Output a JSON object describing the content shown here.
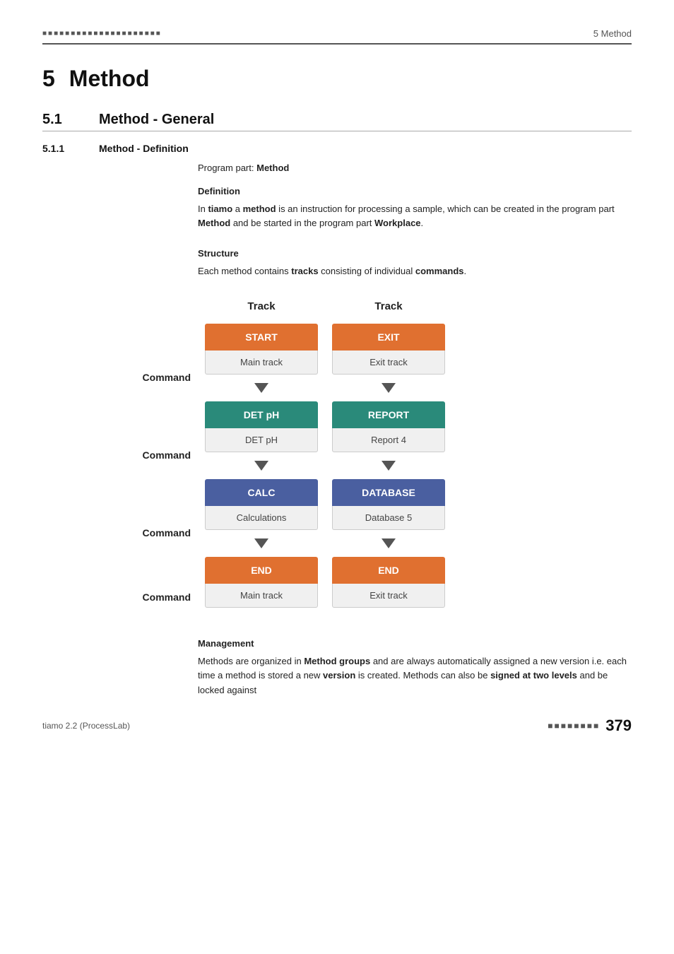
{
  "header": {
    "dots": "■■■■■■■■■■■■■■■■■■■■■",
    "title": "5 Method"
  },
  "chapter": {
    "num": "5",
    "title": "Method"
  },
  "section": {
    "num": "5.1",
    "title": "Method - General"
  },
  "subsection": {
    "num": "5.1.1",
    "title": "Method - Definition"
  },
  "program_part_label": "Program part:",
  "program_part_value": "Method",
  "definition_heading": "Definition",
  "definition_text": "In tiamo a method is an instruction for processing a sample, which can be created in the program part Method and be started in the program part Workplace.",
  "structure_heading": "Structure",
  "structure_text": "Each method contains tracks consisting of individual commands.",
  "diagram": {
    "track_header_main": "Track",
    "track_header_exit": "Track",
    "command_label": "Command",
    "rows": [
      {
        "main_top_text": "START",
        "main_bottom_text": "Main track",
        "exit_top_text": "EXIT",
        "exit_bottom_text": "Exit track",
        "main_color": "color-orange",
        "exit_color": "color-orange"
      },
      {
        "main_top_text": "DET pH",
        "main_bottom_text": "DET pH",
        "exit_top_text": "REPORT",
        "exit_bottom_text": "Report 4",
        "main_color": "color-teal",
        "exit_color": "color-teal"
      },
      {
        "main_top_text": "CALC",
        "main_bottom_text": "Calculations",
        "exit_top_text": "DATABASE",
        "exit_bottom_text": "Database 5",
        "main_color": "color-blue",
        "exit_color": "color-blue"
      },
      {
        "main_top_text": "END",
        "main_bottom_text": "Main track",
        "exit_top_text": "END",
        "exit_bottom_text": "Exit track",
        "main_color": "color-orange",
        "exit_color": "color-orange"
      }
    ]
  },
  "management_heading": "Management",
  "management_text": "Methods are organized in Method groups and are always automatically assigned a new version i.e. each time a method is stored a new version is created. Methods can also be signed at two levels and be locked against",
  "footer": {
    "app_name": "tiamo 2.2 (ProcessLab)",
    "dots": "■■■■■■■■",
    "page_num": "379"
  }
}
